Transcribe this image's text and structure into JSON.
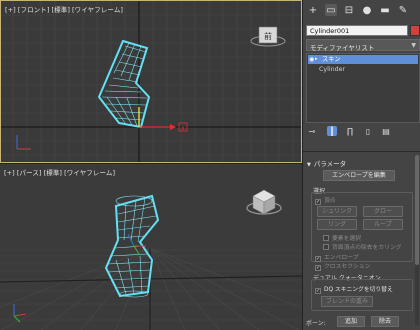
{
  "viewports": {
    "front": {
      "label_parts": [
        "[+]",
        "[フロント]",
        "[標準]",
        "[ワイヤフレーム]"
      ],
      "cube_label": "前"
    },
    "perspective": {
      "label_parts": [
        "[+]",
        "[パース]",
        "[標準]",
        "[ワイヤフレーム]"
      ]
    }
  },
  "command_panel": {
    "tabs": [
      {
        "icon": "create-icon",
        "glyph": "+"
      },
      {
        "icon": "modify-icon",
        "glyph": "▭"
      },
      {
        "icon": "hierarchy-icon",
        "glyph": "⊟"
      },
      {
        "icon": "motion-icon",
        "glyph": "●"
      },
      {
        "icon": "display-icon",
        "glyph": "▬"
      },
      {
        "icon": "utilities-icon",
        "glyph": "✎"
      }
    ],
    "object_name": "Cylinder001",
    "object_color": "#d3403d",
    "modifier_list_label": "モディファイヤリスト",
    "stack": {
      "selected_modifier": "スキン",
      "base_object": "Cylinder"
    },
    "skin_rollout": {
      "title": "パラメータ",
      "edit_envelope_button": "エンベロープを編集",
      "select_group_label": "選択",
      "vertices_label": "頂点",
      "shrink_button": "シュリンク",
      "grow_button": "グロー",
      "ring_button": "リング",
      "loop_button": "ループ",
      "select_element_label": "要素を選択",
      "backface_cull_label": "背面頂点の除去をカリング",
      "envelopes_label": "エンベロープ",
      "cross_sections_label": "クロスセクション",
      "dual_quaternion_label": "デュアル クォータニオン",
      "dq_skinning_label": "DQ スキニングを切り替え",
      "blend_weights_button": "ブレンドの重み",
      "bones_label": "ボーン:",
      "add_button": "追加",
      "remove_button": "除去"
    },
    "accent_color": "#5f8fd8"
  }
}
